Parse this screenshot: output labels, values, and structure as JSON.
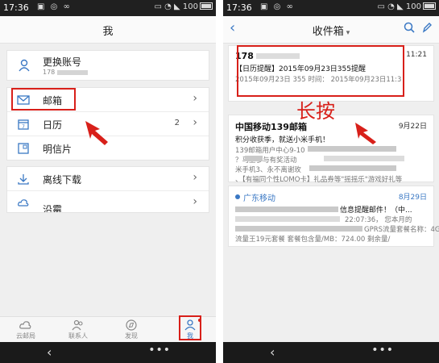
{
  "status_bar": {
    "time": "17:36",
    "battery": "100"
  },
  "left": {
    "title": "我",
    "account": {
      "label": "更换账号",
      "number": "178"
    },
    "menu1": [
      {
        "label": "邮箱",
        "count": ""
      },
      {
        "label": "日历",
        "count": "2"
      },
      {
        "label": "明信片",
        "count": ""
      }
    ],
    "menu2": [
      {
        "label": "离线下载"
      },
      {
        "label": "沿霉"
      }
    ],
    "tabs": [
      {
        "label": "云邮局"
      },
      {
        "label": "联系人"
      },
      {
        "label": "发现"
      },
      {
        "label": "我"
      }
    ]
  },
  "right": {
    "title": "收件箱",
    "mails": [
      {
        "from": "178",
        "date": "11:21",
        "subject": "【日历提醒】2015年09月23日355提醒",
        "preview": "2015年09月23日 355 时间： 2015年09月23日11:3"
      },
      {
        "from": "中国移动139邮箱",
        "date": "9月22日",
        "subject": "积分收获季，就送小米手机！",
        "preview1": "139邮箱用户中心9-10",
        "preview2": "？马上参与有奖活动",
        "preview3": "米手机3、永不离谢玫",
        "preview4": "、【有福同个性LOMO卡】礼品券等\"摇摇乐\"游戏好礼等"
      },
      {
        "from": "广东移动",
        "date": "8月29日",
        "subject": "信息提醒邮件！（中...",
        "preview1": "22:07:36， 您本月的",
        "preview2": "GPRS流量套餐名称：4G",
        "preview3": "流量王19元套餐 套餐包含量/MB：724.00 剩余量/"
      }
    ]
  },
  "annotation": "长按",
  "icons": {
    "mail": "mail-icon",
    "calendar": "calendar-icon",
    "postcard": "postcard-icon",
    "download": "download-icon",
    "cloud": "cloud-icon"
  },
  "colors": {
    "accent": "#3a78c4",
    "highlight": "#d8201a",
    "bar": "#202020"
  }
}
